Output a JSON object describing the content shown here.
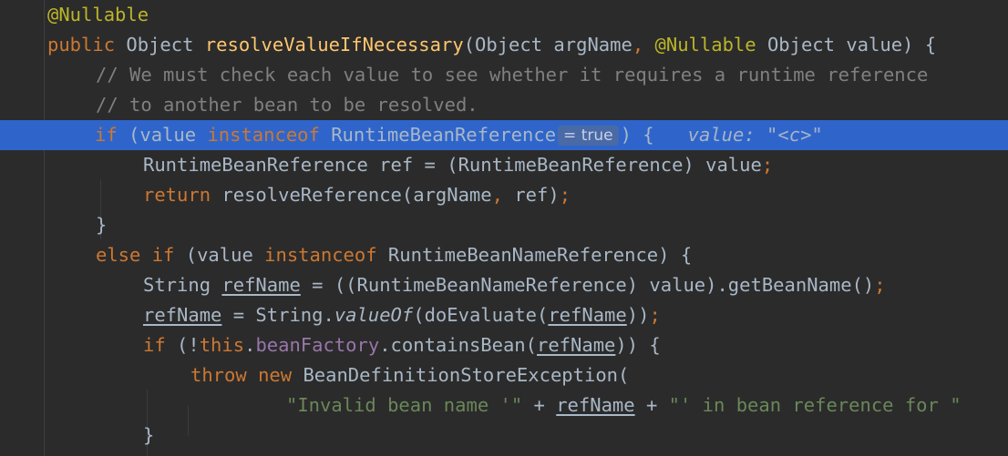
{
  "editor": {
    "lines": [
      {
        "tokens": [
          {
            "t": "@Nullable",
            "c": "ann"
          }
        ]
      },
      {
        "tokens": [
          {
            "t": "public ",
            "c": "kw"
          },
          {
            "t": "Object "
          },
          {
            "t": "resolveValueIfNecessary",
            "c": "fn"
          },
          {
            "t": "(Object argName"
          },
          {
            "t": ", ",
            "c": "punc"
          },
          {
            "t": "@Nullable ",
            "c": "ann"
          },
          {
            "t": "Object value) {"
          }
        ]
      },
      {
        "tokens": [
          {
            "t": "// We must check each value to see whether it requires a runtime reference",
            "c": "cmt"
          }
        ]
      },
      {
        "tokens": [
          {
            "t": "// to another bean to be resolved.",
            "c": "cmt"
          }
        ]
      },
      {
        "tokens": [
          {
            "t": "if ",
            "c": "kw"
          },
          {
            "t": "(value "
          },
          {
            "t": "instanceof ",
            "c": "kw"
          },
          {
            "t": "RuntimeBeanReference"
          }
        ],
        "inlay": "= true",
        "after": ") {",
        "inline_value": "value: \"<c>\""
      },
      {
        "tokens": [
          {
            "t": "RuntimeBeanReference ref = (RuntimeBeanReference) value"
          },
          {
            "t": ";",
            "c": "punc"
          }
        ]
      },
      {
        "tokens": [
          {
            "t": "return ",
            "c": "kw"
          },
          {
            "t": "resolveReference(argName"
          },
          {
            "t": ", ",
            "c": "punc"
          },
          {
            "t": "ref)"
          },
          {
            "t": ";",
            "c": "punc"
          }
        ]
      },
      {
        "tokens": [
          {
            "t": "}"
          }
        ]
      },
      {
        "tokens": [
          {
            "t": "else if ",
            "c": "kw"
          },
          {
            "t": "(value "
          },
          {
            "t": "instanceof ",
            "c": "kw"
          },
          {
            "t": "RuntimeBeanNameReference) {"
          }
        ]
      },
      {
        "tokens": [
          {
            "t": "String "
          },
          {
            "t": "refName",
            "c": "ul"
          },
          {
            "t": " = ((RuntimeBeanNameReference) value).getBeanName()"
          },
          {
            "t": ";",
            "c": "punc"
          }
        ]
      },
      {
        "tokens": [
          {
            "t": "refName",
            "c": "ul"
          },
          {
            "t": " = String."
          },
          {
            "t": "valueOf",
            "c": "ital"
          },
          {
            "t": "(doEvaluate("
          },
          {
            "t": "refName",
            "c": "ul"
          },
          {
            "t": "))"
          },
          {
            "t": ";",
            "c": "punc"
          }
        ]
      },
      {
        "tokens": [
          {
            "t": "if ",
            "c": "kw"
          },
          {
            "t": "(!"
          },
          {
            "t": "this",
            "c": "kw"
          },
          {
            "t": "."
          },
          {
            "t": "beanFactory",
            "c": "fld"
          },
          {
            "t": ".containsBean("
          },
          {
            "t": "refName",
            "c": "ul"
          },
          {
            "t": ")) {"
          }
        ]
      },
      {
        "tokens": [
          {
            "t": "throw ",
            "c": "kw"
          },
          {
            "t": "new ",
            "c": "kw"
          },
          {
            "t": "BeanDefinitionStoreException("
          }
        ]
      },
      {
        "tokens": [
          {
            "t": "\"Invalid bean name '\"",
            "c": "str"
          },
          {
            "t": " + "
          },
          {
            "t": "refName",
            "c": "ul"
          },
          {
            "t": " + "
          },
          {
            "t": "\"' in bean reference for \"",
            "c": "str"
          }
        ]
      },
      {
        "tokens": [
          {
            "t": "}"
          }
        ]
      }
    ]
  },
  "colors": {
    "background": "#2b2b2b",
    "execution_line": "#2f65ca",
    "keyword": "#cc7832",
    "annotation": "#bbb529",
    "method_declaration": "#ffc66d",
    "comment": "#808080",
    "string": "#6a8759",
    "field": "#9876aa"
  }
}
